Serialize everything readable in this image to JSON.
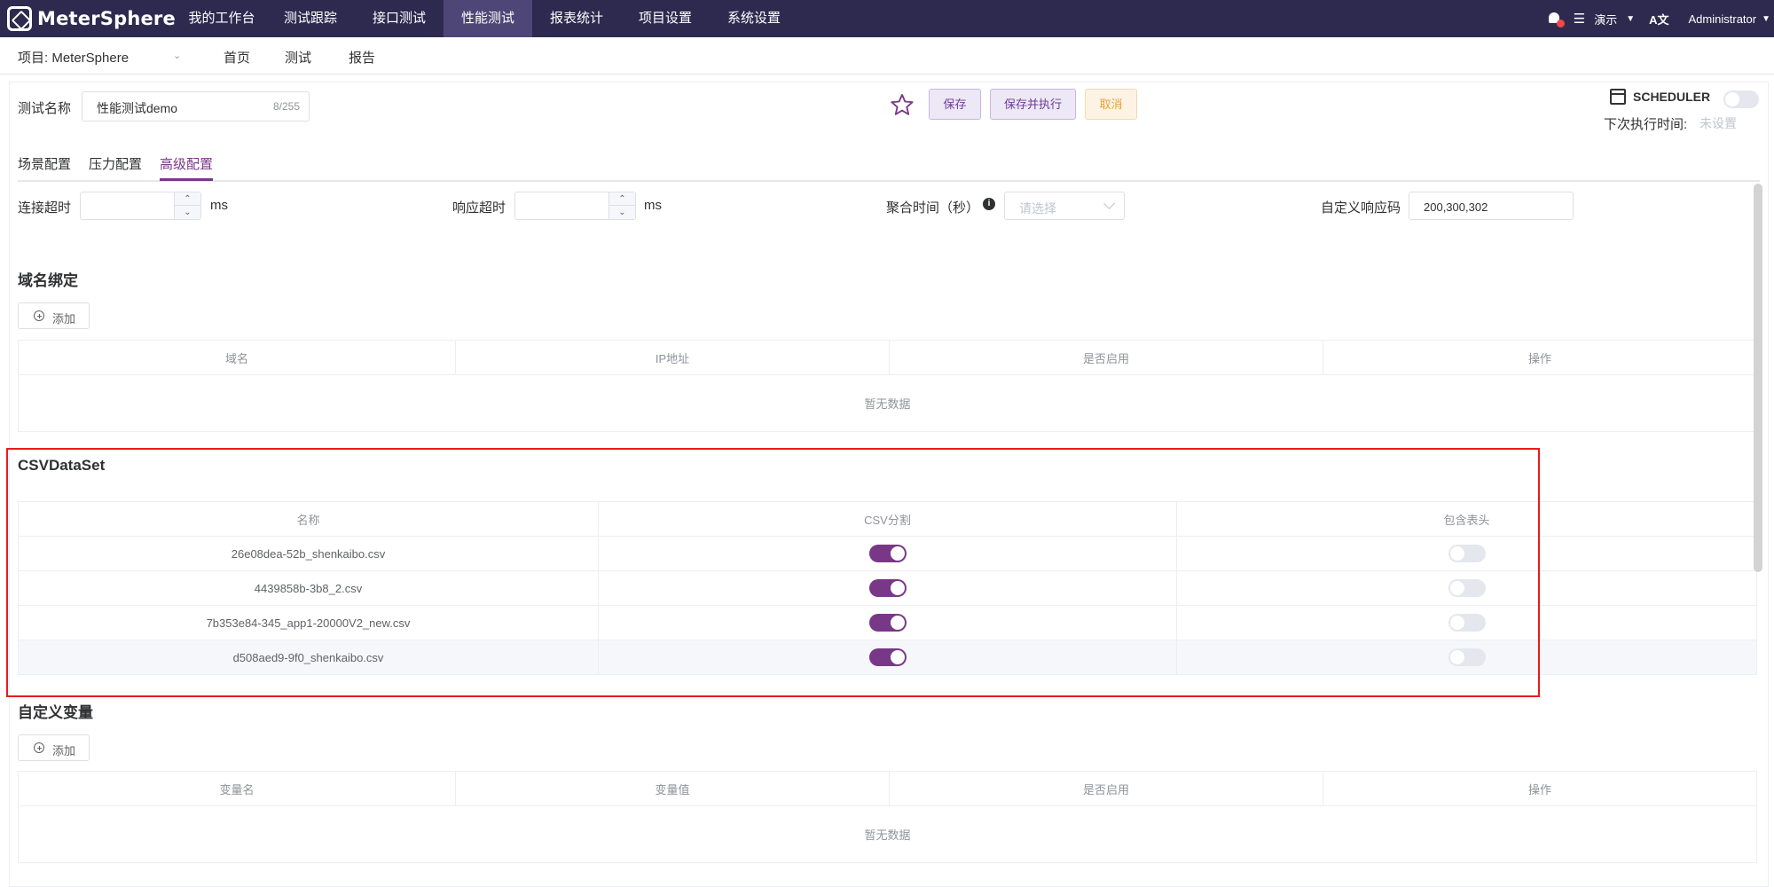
{
  "app": {
    "logo_text": "MeterSphere"
  },
  "nav": {
    "items": [
      {
        "label": "我的工作台"
      },
      {
        "label": "测试跟踪"
      },
      {
        "label": "接口测试"
      },
      {
        "label": "性能测试",
        "active": true
      },
      {
        "label": "报表统计"
      },
      {
        "label": "项目设置"
      },
      {
        "label": "系统设置"
      }
    ],
    "workspace": "演示",
    "lang_label": "A文",
    "user": "Administrator",
    "notification_badge_color": "#f04848"
  },
  "subnav": {
    "project": "项目: MeterSphere",
    "links": [
      {
        "label": "首页"
      },
      {
        "label": "测试"
      },
      {
        "label": "报告"
      }
    ]
  },
  "test": {
    "name_label": "测试名称",
    "name_value": "性能测试demo",
    "name_count": "8/255",
    "save_label": "保存",
    "save_run_label": "保存并执行",
    "cancel_label": "取消",
    "scheduler_label": "SCHEDULER",
    "scheduler_enabled": false,
    "next_run_label": "下次执行时间:",
    "next_run_value": "未设置"
  },
  "tabs": [
    {
      "label": "场景配置"
    },
    {
      "label": "压力配置"
    },
    {
      "label": "高级配置",
      "active": true
    }
  ],
  "advanced": {
    "connect_timeout_label": "连接超时",
    "connect_timeout_unit": "ms",
    "response_timeout_label": "响应超时",
    "response_timeout_unit": "ms",
    "granularity_label": "聚合时间（秒）",
    "granularity_placeholder": "请选择",
    "status_code_label": "自定义响应码",
    "status_code_value": "200,300,302"
  },
  "domain_binding": {
    "title": "域名绑定",
    "add_label": "添加",
    "columns": [
      "域名",
      "IP地址",
      "是否启用",
      "操作"
    ],
    "empty_text": "暂无数据"
  },
  "csv": {
    "title": "CSVDataSet",
    "columns": [
      "名称",
      "CSV分割",
      "包含表头"
    ],
    "rows": [
      {
        "name": "26e08dea-52b_shenkaibo.csv",
        "split": true,
        "header": false
      },
      {
        "name": "4439858b-3b8_2.csv",
        "split": true,
        "header": false
      },
      {
        "name": "7b353e84-345_app1-20000V2_new.csv",
        "split": true,
        "header": false
      },
      {
        "name": "d508aed9-9f0_shenkaibo.csv",
        "split": true,
        "header": false
      }
    ]
  },
  "variables": {
    "title": "自定义变量",
    "add_label": "添加",
    "columns": [
      "变量名",
      "变量值",
      "是否启用",
      "操作"
    ],
    "empty_text": "暂无数据"
  },
  "colors": {
    "nav_bg": "#2e2a4f",
    "accent": "#783887",
    "highlight_box": "#e81b1b"
  }
}
